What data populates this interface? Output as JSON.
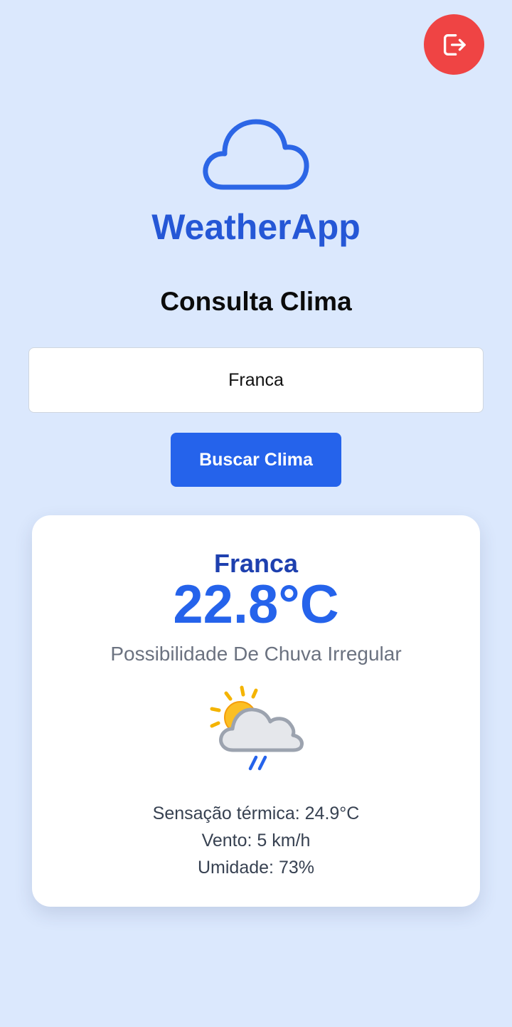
{
  "app": {
    "name": "WeatherApp",
    "logo_icon": "cloud-icon",
    "logout_icon": "logout-icon"
  },
  "search": {
    "title": "Consulta Clima",
    "city_value": "Franca",
    "button_label": "Buscar Clima"
  },
  "result": {
    "city": "Franca",
    "temperature": "22.8°C",
    "description": "Possibilidade De Chuva Irregular",
    "condition_icon": "patchy-rain-icon",
    "feels_like": "Sensação térmica: 24.9°C",
    "wind": "Vento: 5 km/h",
    "humidity": "Umidade: 73%"
  },
  "colors": {
    "background": "#dbe8fd",
    "primary": "#2563eb",
    "brand": "#2557d6",
    "city": "#1e40af",
    "logout": "#ef4444"
  }
}
